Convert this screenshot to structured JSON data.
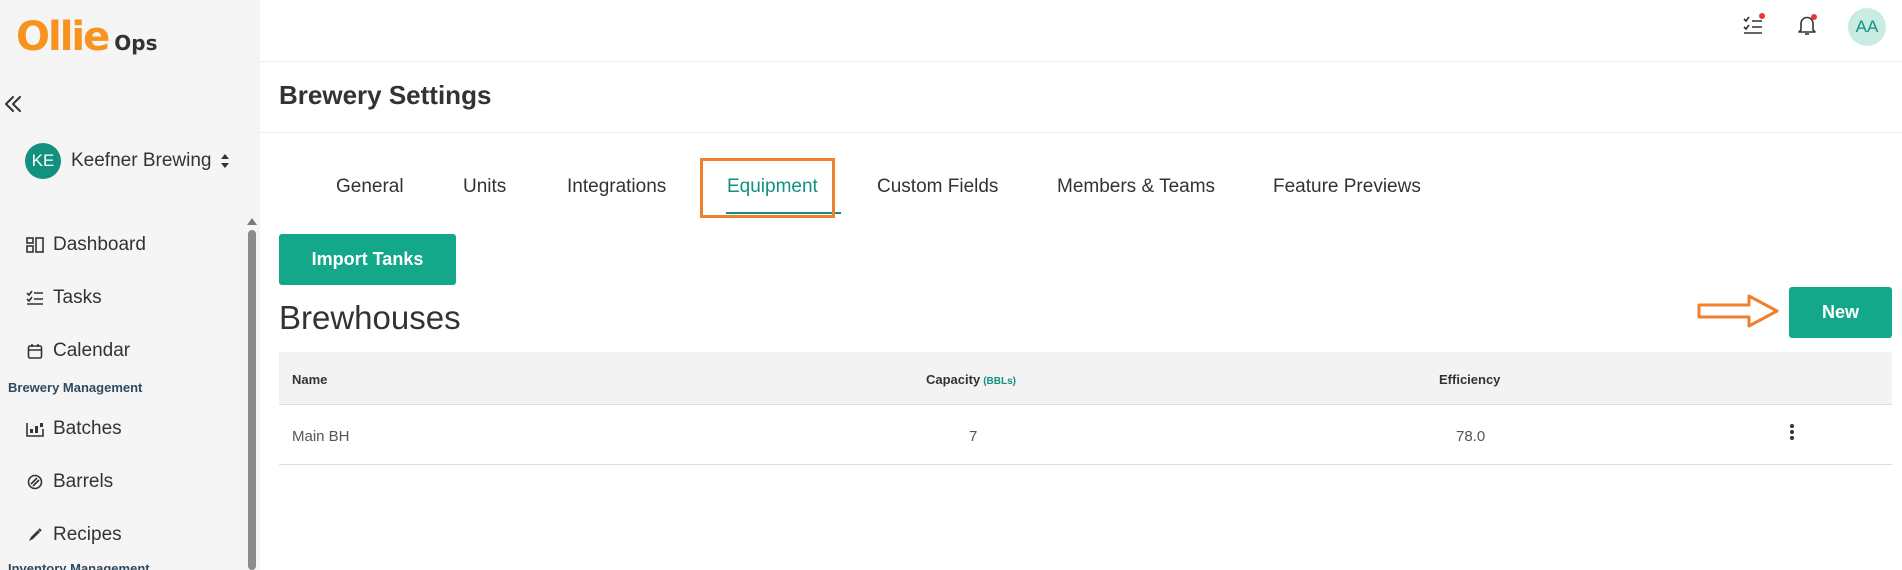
{
  "app": {
    "logo_main": "Ollie",
    "logo_sub": "Ops"
  },
  "sidebar": {
    "org_initials": "KE",
    "org_name": "Keefner Brewing",
    "items": [
      {
        "label": "Dashboard",
        "icon": "dashboard-icon"
      },
      {
        "label": "Tasks",
        "icon": "tasks-icon"
      },
      {
        "label": "Calendar",
        "icon": "calendar-icon"
      }
    ],
    "section_label": "Brewery Management",
    "section_items": [
      {
        "label": "Batches",
        "icon": "batches-icon"
      },
      {
        "label": "Barrels",
        "icon": "barrels-icon"
      },
      {
        "label": "Recipes",
        "icon": "recipes-icon"
      }
    ],
    "next_section_label": "Inventory Management"
  },
  "topbar": {
    "user_initials": "AA"
  },
  "page": {
    "title": "Brewery Settings"
  },
  "tabs": [
    {
      "label": "General",
      "active": false
    },
    {
      "label": "Units",
      "active": false
    },
    {
      "label": "Integrations",
      "active": false
    },
    {
      "label": "Equipment",
      "active": true
    },
    {
      "label": "Custom Fields",
      "active": false
    },
    {
      "label": "Members & Teams",
      "active": false
    },
    {
      "label": "Feature Previews",
      "active": false
    }
  ],
  "actions": {
    "import_tanks": "Import Tanks",
    "new": "New"
  },
  "brewhouses": {
    "heading": "Brewhouses",
    "columns": {
      "name": "Name",
      "capacity": "Capacity",
      "capacity_unit": "(BBLs)",
      "efficiency": "Efficiency"
    },
    "rows": [
      {
        "name": "Main BH",
        "capacity": "7",
        "efficiency": "78.0"
      }
    ]
  },
  "colors": {
    "brand_orange": "#f7931e",
    "accent_teal": "#13a88a",
    "annotation_orange": "#f07f2e"
  }
}
